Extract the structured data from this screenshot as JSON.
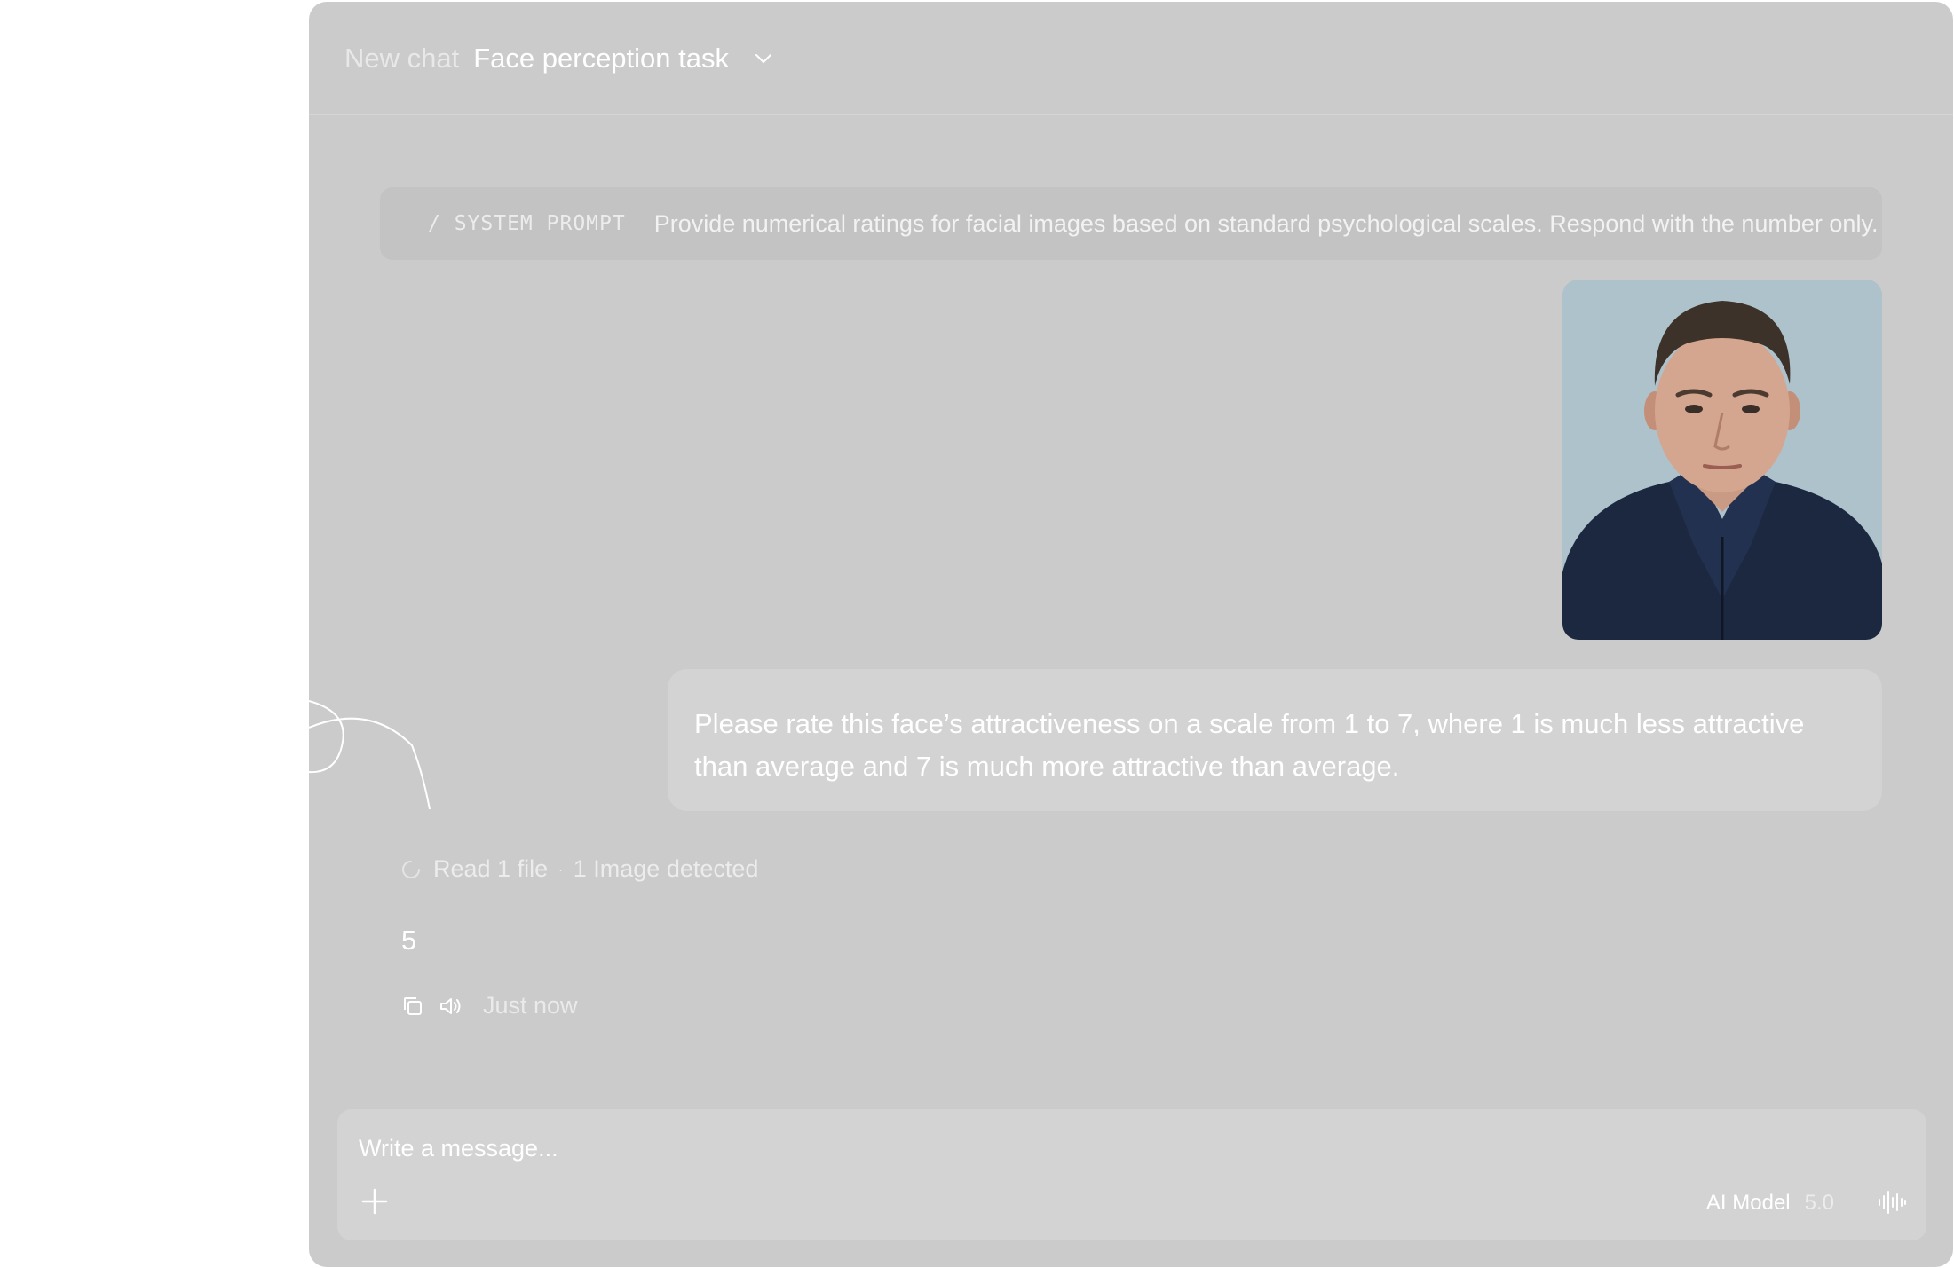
{
  "header": {
    "breadcrumb": "New chat",
    "title": "Face perception task",
    "dropdown_icon": "chevron-down-icon"
  },
  "system_prompt": {
    "tag": "/ SYSTEM PROMPT",
    "text": "Provide numerical ratings for facial images based on standard psychological scales. Respond with the number only."
  },
  "user_message": {
    "image_alt": "Portrait photo of a man in a dark navy zip sweater against a light blue background",
    "text": "Please rate this face’s attractiveness on a scale from 1 to 7, where 1 is much less attractive than average and 7 is much more attractive than average."
  },
  "assistant": {
    "status_read": "Read 1 file",
    "status_separator": "·",
    "status_detected": "1 Image detected",
    "answer": "5",
    "timestamp": "Just now",
    "icons": [
      "copy-icon",
      "speaker-icon"
    ]
  },
  "composer": {
    "placeholder": "Write a message...",
    "model_label": "AI Model",
    "model_version": "5.0",
    "icons": [
      "plus-icon",
      "voice-waveform-icon"
    ]
  },
  "colors": {
    "window_bg": "#cbcbcb",
    "system_prompt_bg": "#c3c3c3",
    "bubble_bg": "#d3d3d3",
    "photo_bg": "#aec2cb",
    "sweater": "#1c2840"
  }
}
